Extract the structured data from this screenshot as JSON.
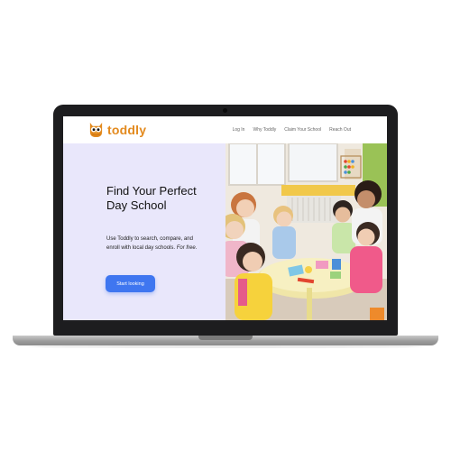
{
  "brand": {
    "name": "toddly",
    "logo_icon": "owl-icon",
    "color": "#e38a1e"
  },
  "nav": {
    "items": [
      {
        "label": "Log In"
      },
      {
        "label": "Why Toddly"
      },
      {
        "label": "Claim Your School"
      },
      {
        "label": "Reach Out"
      }
    ]
  },
  "hero": {
    "title": "Find Your Perfect Day School",
    "subtitle": "Use Toddly to search, compare, and enroll with local day schools.",
    "subtitle_emphasis": "For free.",
    "cta_label": "Start looking",
    "cta_color": "#3f76f0",
    "panel_color": "#e9e7fb",
    "photo_icon": "classroom-children-photo"
  }
}
